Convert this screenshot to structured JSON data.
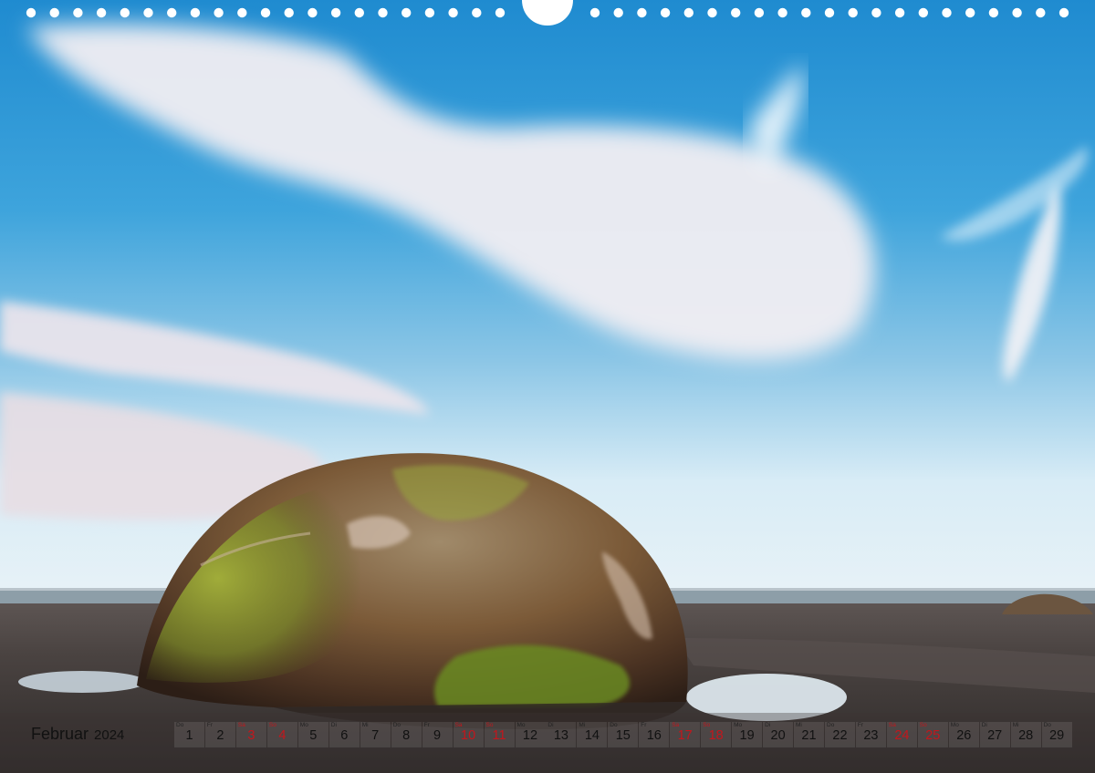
{
  "calendar": {
    "month": "Februar",
    "year": "2024",
    "days": [
      {
        "num": "1",
        "dow": "Do",
        "red": false
      },
      {
        "num": "2",
        "dow": "Fr",
        "red": false
      },
      {
        "num": "3",
        "dow": "Sa",
        "red": true
      },
      {
        "num": "4",
        "dow": "So",
        "red": true
      },
      {
        "num": "5",
        "dow": "Mo",
        "red": false
      },
      {
        "num": "6",
        "dow": "Di",
        "red": false
      },
      {
        "num": "7",
        "dow": "Mi",
        "red": false
      },
      {
        "num": "8",
        "dow": "Do",
        "red": false
      },
      {
        "num": "9",
        "dow": "Fr",
        "red": false
      },
      {
        "num": "10",
        "dow": "Sa",
        "red": true
      },
      {
        "num": "11",
        "dow": "So",
        "red": true
      },
      {
        "num": "12",
        "dow": "Mo",
        "red": false
      },
      {
        "num": "13",
        "dow": "Di",
        "red": false
      },
      {
        "num": "14",
        "dow": "Mi",
        "red": false
      },
      {
        "num": "15",
        "dow": "Do",
        "red": false
      },
      {
        "num": "16",
        "dow": "Fr",
        "red": false
      },
      {
        "num": "17",
        "dow": "Sa",
        "red": true
      },
      {
        "num": "18",
        "dow": "So",
        "red": true
      },
      {
        "num": "19",
        "dow": "Mo",
        "red": false
      },
      {
        "num": "20",
        "dow": "Di",
        "red": false
      },
      {
        "num": "21",
        "dow": "Mi",
        "red": false
      },
      {
        "num": "22",
        "dow": "Do",
        "red": false
      },
      {
        "num": "23",
        "dow": "Fr",
        "red": false
      },
      {
        "num": "24",
        "dow": "Sa",
        "red": true
      },
      {
        "num": "25",
        "dow": "So",
        "red": true
      },
      {
        "num": "26",
        "dow": "Mo",
        "red": false
      },
      {
        "num": "27",
        "dow": "Di",
        "red": false
      },
      {
        "num": "28",
        "dow": "Mi",
        "red": false
      },
      {
        "num": "29",
        "dow": "Do",
        "red": false
      }
    ]
  },
  "colors": {
    "holiday": "#c4161c",
    "text": "#111111"
  }
}
